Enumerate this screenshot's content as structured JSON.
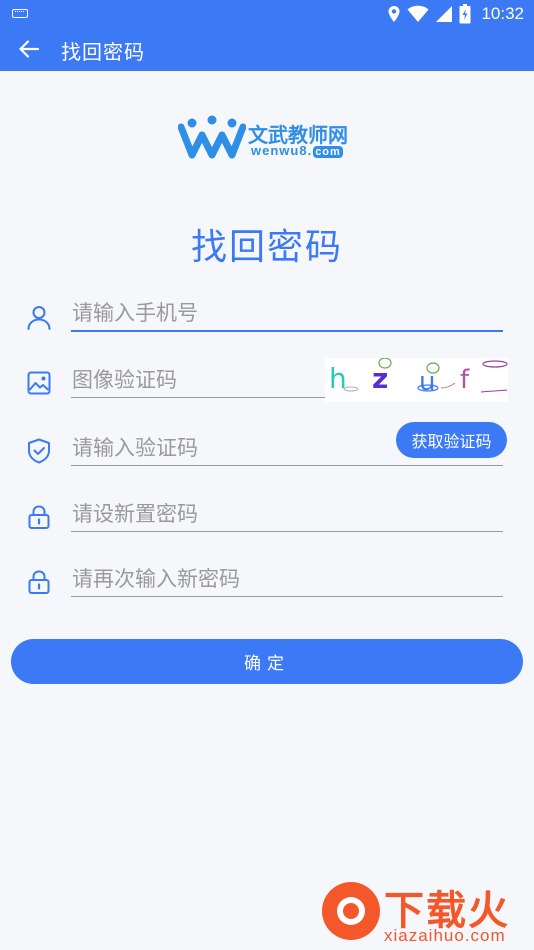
{
  "status_bar": {
    "time": "10:32"
  },
  "app_bar": {
    "title": "找回密码"
  },
  "logo": {
    "brand": "文武教师网",
    "domain_main": "wenwu8.",
    "domain_suffix": "com"
  },
  "heading": "找回密码",
  "form": {
    "phone_placeholder": "请输入手机号",
    "captcha_placeholder": "图像验证码",
    "captcha_chars": [
      "h",
      "z",
      "u",
      "f"
    ],
    "sms_placeholder": "请输入验证码",
    "sms_button": "获取验证码",
    "new_password_placeholder": "请设新置密码",
    "confirm_password_placeholder": "请再次输入新密码"
  },
  "confirm_button": "确定",
  "watermark": {
    "text": "下载火",
    "domain": "xiazaihuo.com"
  },
  "colors": {
    "primary": "#3b79f5",
    "logo": "#2f8ee6",
    "watermark": "#f4582a"
  }
}
